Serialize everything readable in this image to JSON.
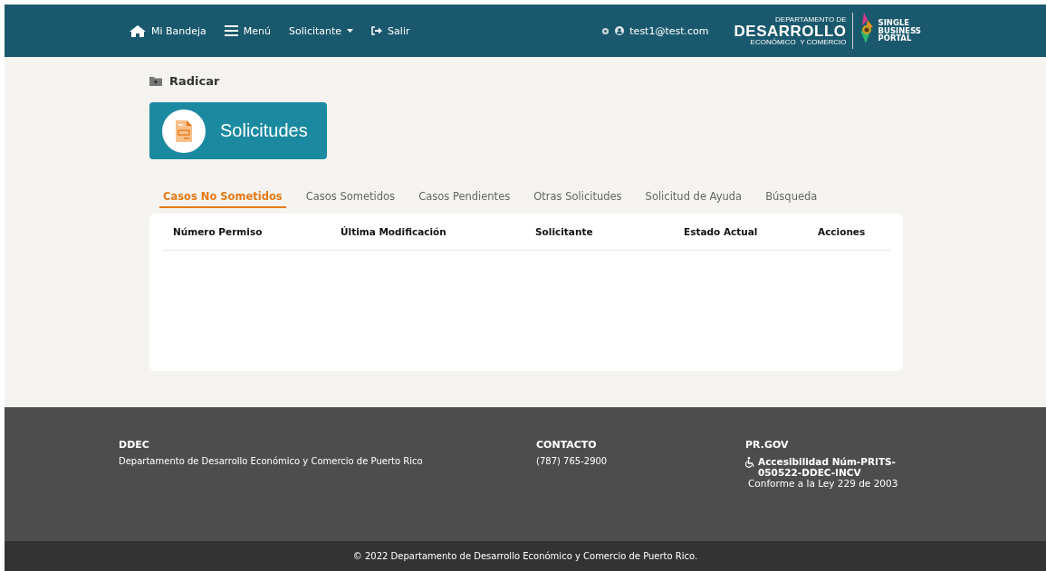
{
  "nav": {
    "items": [
      {
        "kind": "home",
        "label": "Mi Bandeja"
      },
      {
        "kind": "menu",
        "label": "Menú"
      },
      {
        "kind": "dropdown",
        "label": "Solicitante"
      },
      {
        "kind": "logout",
        "label": "Salir"
      }
    ],
    "user": "test1@test.com",
    "logo": {
      "top": "DEPARTAMENTO DE",
      "main": "DESARROLLO",
      "sub": "ECONÓMICO  Y COMERCIO",
      "portal": [
        "SINGLE",
        "BUSINESS",
        "PORTAL"
      ]
    }
  },
  "radicar": "Radicar",
  "card_title": "Solicitudes",
  "tabs": [
    {
      "label": "Casos No Sometidos",
      "selected": true
    },
    {
      "label": "Casos Sometidos",
      "selected": false
    },
    {
      "label": "Casos Pendientes",
      "selected": false
    },
    {
      "label": "Otras Solicitudes",
      "selected": false
    },
    {
      "label": "Solicitud de Ayuda",
      "selected": false
    },
    {
      "label": "Búsqueda",
      "selected": false
    }
  ],
  "table": {
    "columns": [
      "Número Permiso",
      "Última Modificación",
      "Solicitante",
      "Estado Actual",
      "Acciones"
    ]
  },
  "footer": {
    "columns": [
      {
        "title": "DDEC",
        "lines": [
          "Departamento de Desarrollo Económico y Comercio de Puerto Rico"
        ]
      },
      {
        "title": "CONTACTO",
        "lines": [
          "(787) 765-2900"
        ]
      },
      {
        "title": "PR.GOV",
        "accessibility": "Accesibilidad Núm-PRITS-050522-DDEC-INCV",
        "lines": [
          "Conforme a la Ley 229 de 2003"
        ]
      }
    ],
    "copyright": "© 2022 Departamento de Desarrollo Económico y Comercio de Puerto Rico."
  }
}
